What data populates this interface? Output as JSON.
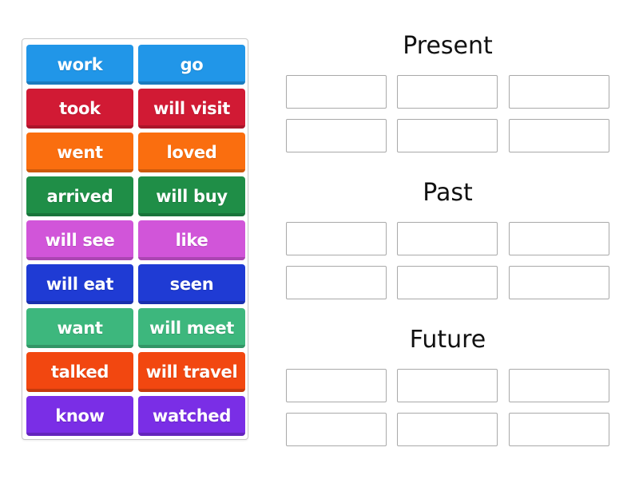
{
  "word_bank": {
    "tiles": [
      {
        "label": "work",
        "color": "#2196e8"
      },
      {
        "label": "go",
        "color": "#2196e8"
      },
      {
        "label": "took",
        "color": "#d11a34"
      },
      {
        "label": "will visit",
        "color": "#d11a34"
      },
      {
        "label": "went",
        "color": "#fa6e0f"
      },
      {
        "label": "loved",
        "color": "#fa6e0f"
      },
      {
        "label": "arrived",
        "color": "#1f8e47"
      },
      {
        "label": "will buy",
        "color": "#1f8e47"
      },
      {
        "label": "will see",
        "color": "#d155d9"
      },
      {
        "label": "like",
        "color": "#d155d9"
      },
      {
        "label": "will eat",
        "color": "#1f3bd4"
      },
      {
        "label": "seen",
        "color": "#1f3bd4"
      },
      {
        "label": "want",
        "color": "#3db77d"
      },
      {
        "label": "will meet",
        "color": "#3db77d"
      },
      {
        "label": "talked",
        "color": "#f24710"
      },
      {
        "label": "will travel",
        "color": "#f24710"
      },
      {
        "label": "know",
        "color": "#7a2ee6"
      },
      {
        "label": "watched",
        "color": "#7a2ee6"
      }
    ]
  },
  "groups": [
    {
      "title": "Present",
      "slots": 6
    },
    {
      "title": "Past",
      "slots": 6
    },
    {
      "title": "Future",
      "slots": 6
    }
  ]
}
